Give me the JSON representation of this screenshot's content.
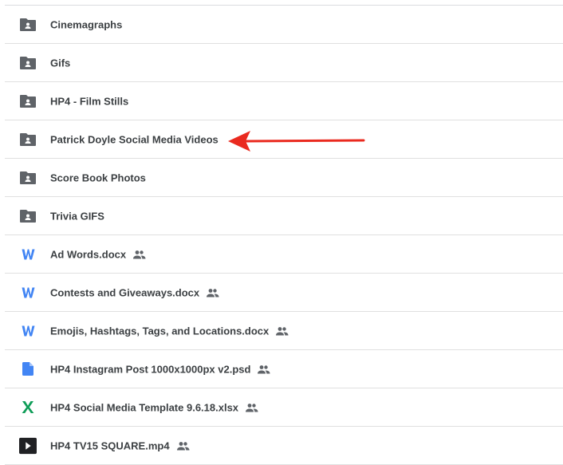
{
  "files": [
    {
      "name": "Cinemagraphs",
      "type": "shared-folder",
      "shared": false
    },
    {
      "name": "Gifs",
      "type": "shared-folder",
      "shared": false
    },
    {
      "name": "HP4 - Film Stills",
      "type": "shared-folder",
      "shared": false
    },
    {
      "name": "Patrick Doyle Social Media Videos",
      "type": "shared-folder",
      "shared": false
    },
    {
      "name": "Score Book Photos",
      "type": "shared-folder",
      "shared": false
    },
    {
      "name": "Trivia GIFS",
      "type": "shared-folder",
      "shared": false
    },
    {
      "name": "Ad Words.docx",
      "type": "word",
      "shared": true
    },
    {
      "name": "Contests and Giveaways.docx",
      "type": "word",
      "shared": true
    },
    {
      "name": "Emojis, Hashtags, Tags, and Locations.docx",
      "type": "word",
      "shared": true
    },
    {
      "name": "HP4 Instagram Post 1000x1000px v2.psd",
      "type": "file",
      "shared": true
    },
    {
      "name": "HP4 Social Media Template 9.6.18.xlsx",
      "type": "excel",
      "shared": true
    },
    {
      "name": "HP4 TV15 SQUARE.mp4",
      "type": "video",
      "shared": true
    }
  ],
  "colors": {
    "folder": "#5f6368",
    "word": "#4285f4",
    "file": "#4285f4",
    "excel": "#0f9d58",
    "video": "#202124",
    "arrow": "#ea2a1f"
  },
  "icons": {
    "shared-folder": "shared-folder-icon",
    "word": "word-doc-icon",
    "file": "file-icon",
    "excel": "excel-icon",
    "video": "video-icon",
    "shared": "people-icon"
  }
}
